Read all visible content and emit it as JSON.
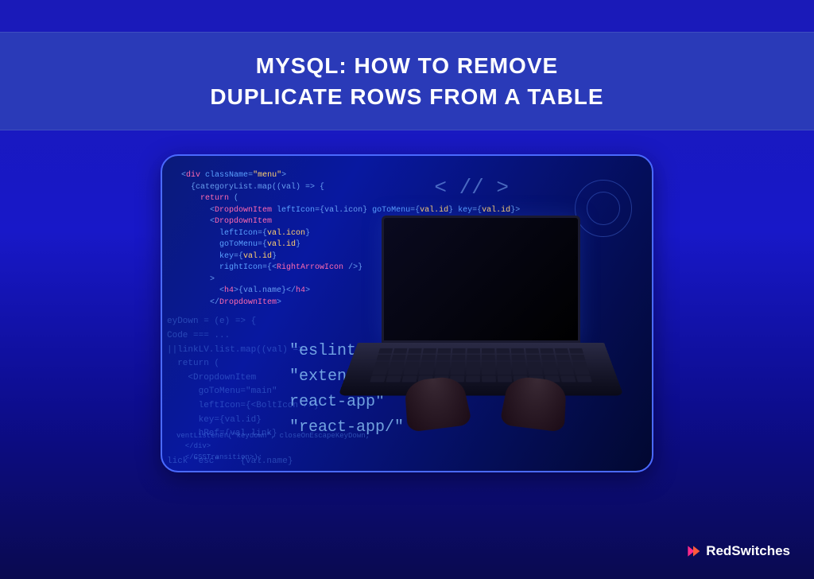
{
  "header": {
    "title_line1": "MYSQL: HOW TO REMOVE",
    "title_line2": "DUPLICATE ROWS FROM A TABLE"
  },
  "hero": {
    "angle_bracket": "< // >",
    "code_block": "<div className=\"menu\">\n  {categoryList.map((val) => {\n    return (\n      <DropdownItem leftIcon={val.icon} goToMenu={val.id} key={val.id}>\n      <DropdownItem\n        leftIcon={val.icon}\n        goToMenu={val.id}\n        key={val.id}\n        rightIcon={<RightArrowIcon />}\n      >\n        <h4>{val.name}</h4>\n      </DropdownItem>",
    "faded_lines": "eyDown = (e) => {\nCode === ...\n||linkLV.list.map((val) =>\n  return (\n    <DropdownItem\n      goToMenu=\"main\"\n      leftIcon={<BoltIcon />}\n      key={val.id}\n      hRef={val.link}\n\nlick \"esc\"    {val.name}\n      </DropdownItem>",
    "floating_words": [
      "\"eslintConfig",
      "\"extends\":",
      "react-app\"",
      "\"react-app/\""
    ],
    "bottom_code": "ventListener(\"keydown\", closeOnEscapeKeyDown;\n  </div>\n  </CSSTransition>);"
  },
  "brand": {
    "name": "RedSwitches"
  }
}
